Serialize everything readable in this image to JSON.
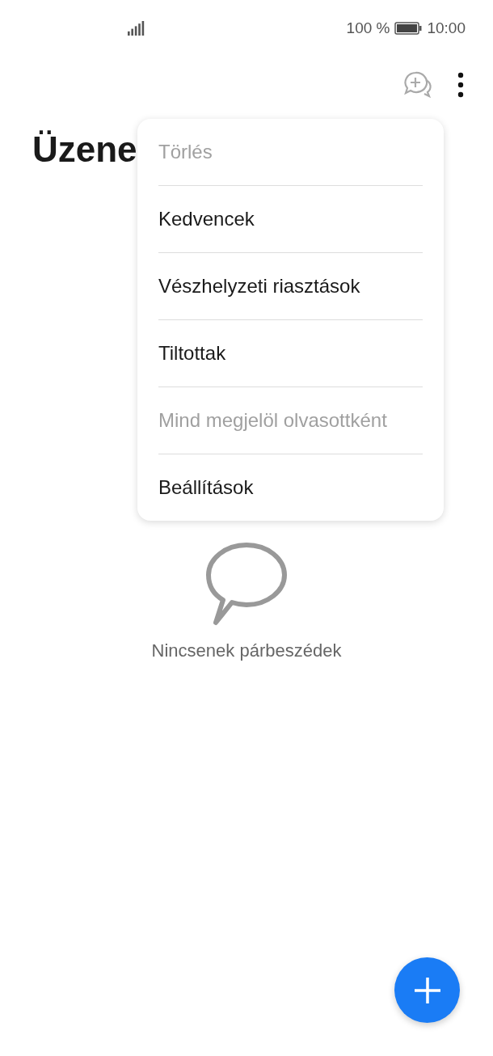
{
  "status_bar": {
    "battery": "100 %",
    "time": "10:00"
  },
  "title": "Üzene",
  "menu": {
    "items": [
      {
        "label": "Törlés",
        "disabled": true
      },
      {
        "label": "Kedvencek",
        "disabled": false
      },
      {
        "label": "Vészhelyzeti riasztások",
        "disabled": false
      },
      {
        "label": "Tiltottak",
        "disabled": false
      },
      {
        "label": "Mind megjelöl olvasottként",
        "disabled": true
      },
      {
        "label": "Beállítások",
        "disabled": false
      }
    ]
  },
  "empty_state": {
    "text": "Nincsenek párbeszédek"
  }
}
